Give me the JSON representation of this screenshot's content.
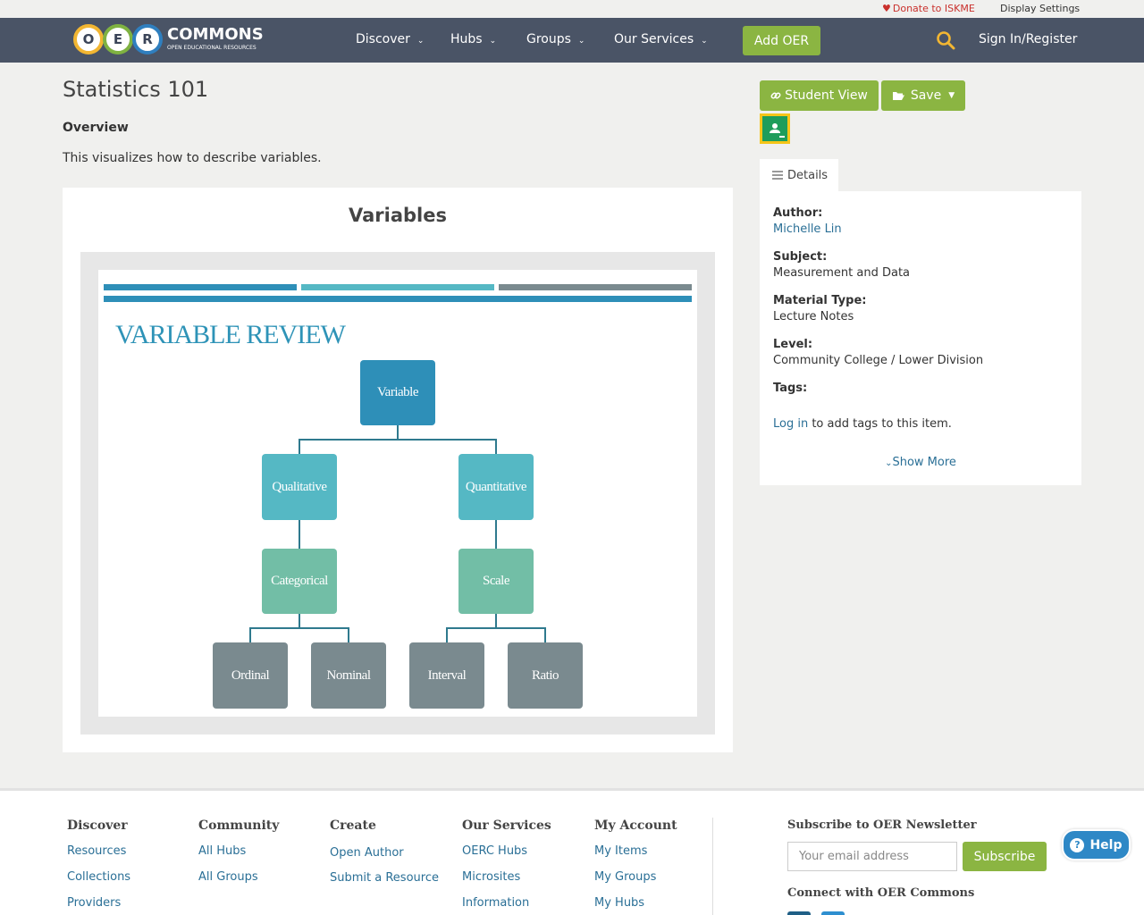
{
  "utility": {
    "donate": "Donate to ISKME",
    "display_settings": "Display Settings"
  },
  "logo": {
    "letters": [
      "O",
      "E",
      "R"
    ],
    "word": "COMMONS",
    "tagline": "OPEN EDUCATIONAL RESOURCES"
  },
  "nav": {
    "items": [
      "Discover",
      "Hubs",
      "Groups",
      "Our Services"
    ],
    "add_oer": "Add OER",
    "sign_in": "Sign In/Register"
  },
  "resource": {
    "title": "Statistics 101",
    "overview_heading": "Overview",
    "overview_text": "This visualizes how to describe variables.",
    "card_title": "Variables"
  },
  "diagram": {
    "slide_title": "VARIABLE REVIEW",
    "root": "Variable",
    "level1": [
      "Qualitative",
      "Quantitative"
    ],
    "level2": [
      "Categorical",
      "Scale"
    ],
    "level3": [
      "Ordinal",
      "Nominal",
      "Interval",
      "Ratio"
    ],
    "colors": {
      "root": "#2e8fb8",
      "level1": "#55b8c4",
      "level2": "#72bea6",
      "level3": "#7a8a8f",
      "bar1": "#2e8fb8",
      "bar2": "#55b8c4",
      "bar3": "#7a8a8f"
    }
  },
  "actions": {
    "student_view": "Student View",
    "save": "Save"
  },
  "details": {
    "tab": "Details",
    "author_label": "Author:",
    "author": "Michelle Lin",
    "subject_label": "Subject:",
    "subject": "Measurement and Data",
    "material_label": "Material Type:",
    "material": "Lecture Notes",
    "level_label": "Level:",
    "level": "Community College / Lower Division",
    "tags_label": "Tags:",
    "login_link": "Log in",
    "login_rest": " to add tags to this item.",
    "show_more": "Show More"
  },
  "footer": {
    "columns": [
      {
        "heading": "Discover",
        "links": [
          "Resources",
          "Collections",
          "Providers"
        ]
      },
      {
        "heading": "Community",
        "links": [
          "All Hubs",
          "All Groups"
        ]
      },
      {
        "heading": "Create",
        "links": [
          "Open Author",
          "Submit a Resource"
        ]
      },
      {
        "heading": "Our Services",
        "links": [
          "OERC Hubs",
          "Microsites",
          "Information"
        ]
      },
      {
        "heading": "My Account",
        "links": [
          "My Items",
          "My Groups",
          "My Hubs"
        ]
      }
    ],
    "newsletter_heading": "Subscribe to OER Newsletter",
    "email_placeholder": "Your email address",
    "subscribe": "Subscribe",
    "connect_heading": "Connect with OER Commons"
  },
  "help": "Help"
}
